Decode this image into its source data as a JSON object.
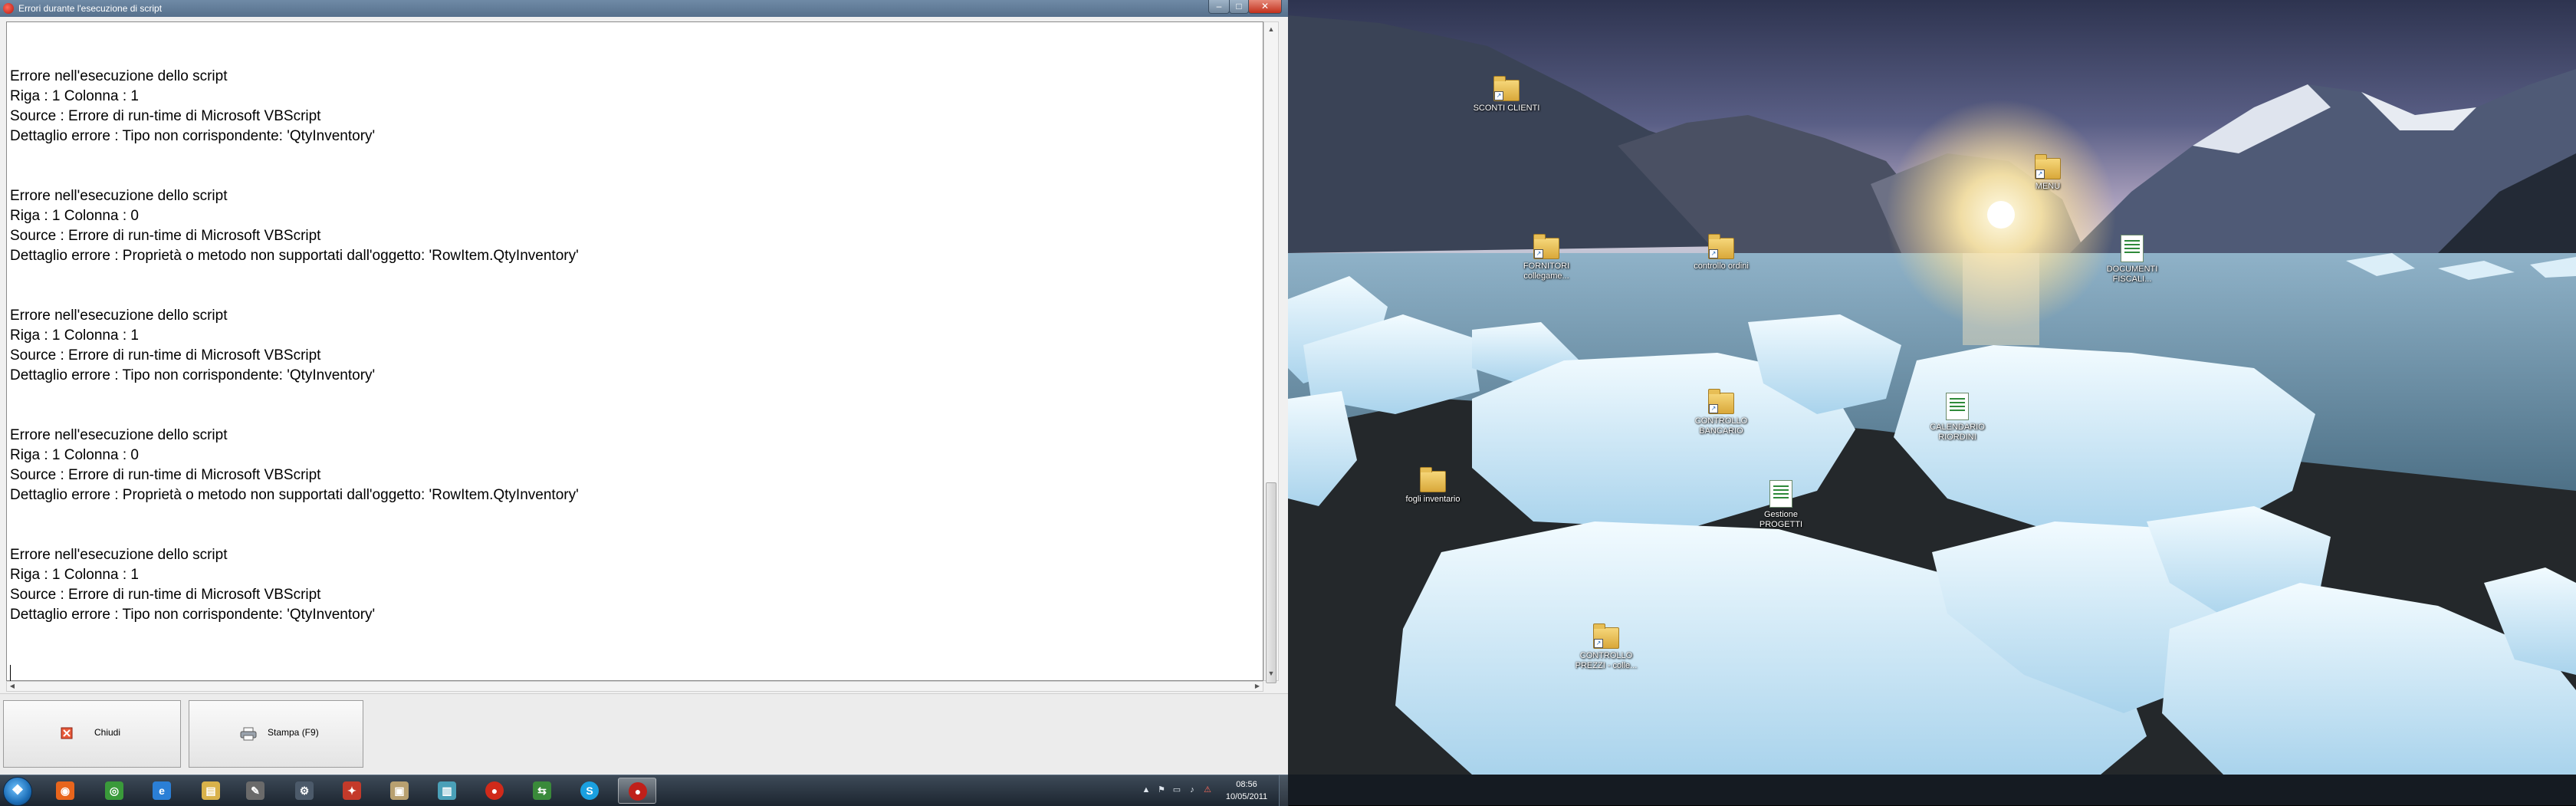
{
  "window": {
    "title": "Errori durante l'esecuzione di script",
    "controls": {
      "minimize": "–",
      "maximize": "□",
      "close": "✕"
    }
  },
  "errors": [
    {
      "heading": "Errore nell'esecuzione dello script",
      "position": "Riga : 1   Colonna : 1",
      "source": "Source : Errore di run-time di Microsoft VBScript",
      "detail": "Dettaglio errore : Tipo non corrispondente: 'QtyInventory'"
    },
    {
      "heading": "Errore nell'esecuzione dello script",
      "position": "Riga : 1   Colonna : 0",
      "source": "Source : Errore di run-time di Microsoft VBScript",
      "detail": "Dettaglio errore : Proprietà o metodo non supportati dall'oggetto: 'RowItem.QtyInventory'"
    },
    {
      "heading": "Errore nell'esecuzione dello script",
      "position": "Riga : 1   Colonna : 1",
      "source": "Source : Errore di run-time di Microsoft VBScript",
      "detail": "Dettaglio errore : Tipo non corrispondente: 'QtyInventory'"
    },
    {
      "heading": "Errore nell'esecuzione dello script",
      "position": "Riga : 1   Colonna : 0",
      "source": "Source : Errore di run-time di Microsoft VBScript",
      "detail": "Dettaglio errore : Proprietà o metodo non supportati dall'oggetto: 'RowItem.QtyInventory'"
    },
    {
      "heading": "Errore nell'esecuzione dello script",
      "position": "Riga : 1   Colonna : 1",
      "source": "Source : Errore di run-time di Microsoft VBScript",
      "detail": "Dettaglio errore : Tipo non corrispondente: 'QtyInventory'"
    }
  ],
  "buttons": {
    "close_label": "Chiudi",
    "print_label": "Stampa (F9)"
  },
  "scroll": {
    "up": "▲",
    "down": "▼",
    "left": "◀",
    "right": "▶"
  },
  "desktop_icons": [
    {
      "label": "SCONTI CLIENTI",
      "kind": "folder"
    },
    {
      "label": "MENU",
      "kind": "folder"
    },
    {
      "label": "FORNITORI collegame...",
      "kind": "folder"
    },
    {
      "label": "controllo ordini",
      "kind": "folder"
    },
    {
      "label": "DOCUMENTI FISCALI...",
      "kind": "doc"
    },
    {
      "label": "CONTROLLO BANCARIO",
      "kind": "folder"
    },
    {
      "label": "CALENDARIO RIORDINI",
      "kind": "doc"
    },
    {
      "label": "fogli inventario",
      "kind": "folder"
    },
    {
      "label": "Gestione PROGETTI",
      "kind": "doc"
    },
    {
      "label": "CONTROLLO PREZZI - colle...",
      "kind": "folder"
    }
  ],
  "taskbar": {
    "start_glyph": "❖",
    "apps": [
      {
        "name": "firefox",
        "glyph": "◉",
        "color": "#e8651c"
      },
      {
        "name": "chrome",
        "glyph": "◎",
        "color": "#3a9a3a"
      },
      {
        "name": "internet-explorer",
        "glyph": "e",
        "color": "#2b7fd6"
      },
      {
        "name": "explorer",
        "glyph": "▤",
        "color": "#d9b24a"
      },
      {
        "name": "tools",
        "glyph": "✎",
        "color": "#6a6a6a"
      },
      {
        "name": "app-6",
        "glyph": "⚙",
        "color": "#4c5a6a"
      },
      {
        "name": "app-7",
        "glyph": "✦",
        "color": "#c43a2a"
      },
      {
        "name": "app-8",
        "glyph": "▣",
        "color": "#b8a070"
      },
      {
        "name": "app-9",
        "glyph": "▥",
        "color": "#4aa0b8"
      },
      {
        "name": "app-10",
        "glyph": "●",
        "color": "#d02a1a"
      },
      {
        "name": "app-11",
        "glyph": "⇆",
        "color": "#3a8a3a"
      },
      {
        "name": "skype",
        "glyph": "S",
        "color": "#1aa0e0"
      },
      {
        "name": "script-errors",
        "glyph": "●",
        "color": "#c0201a"
      }
    ],
    "tray_icons": [
      "▲",
      "⚑",
      "▭",
      "♪",
      "⚠"
    ],
    "time": "08:56",
    "date": "10/05/2011"
  }
}
